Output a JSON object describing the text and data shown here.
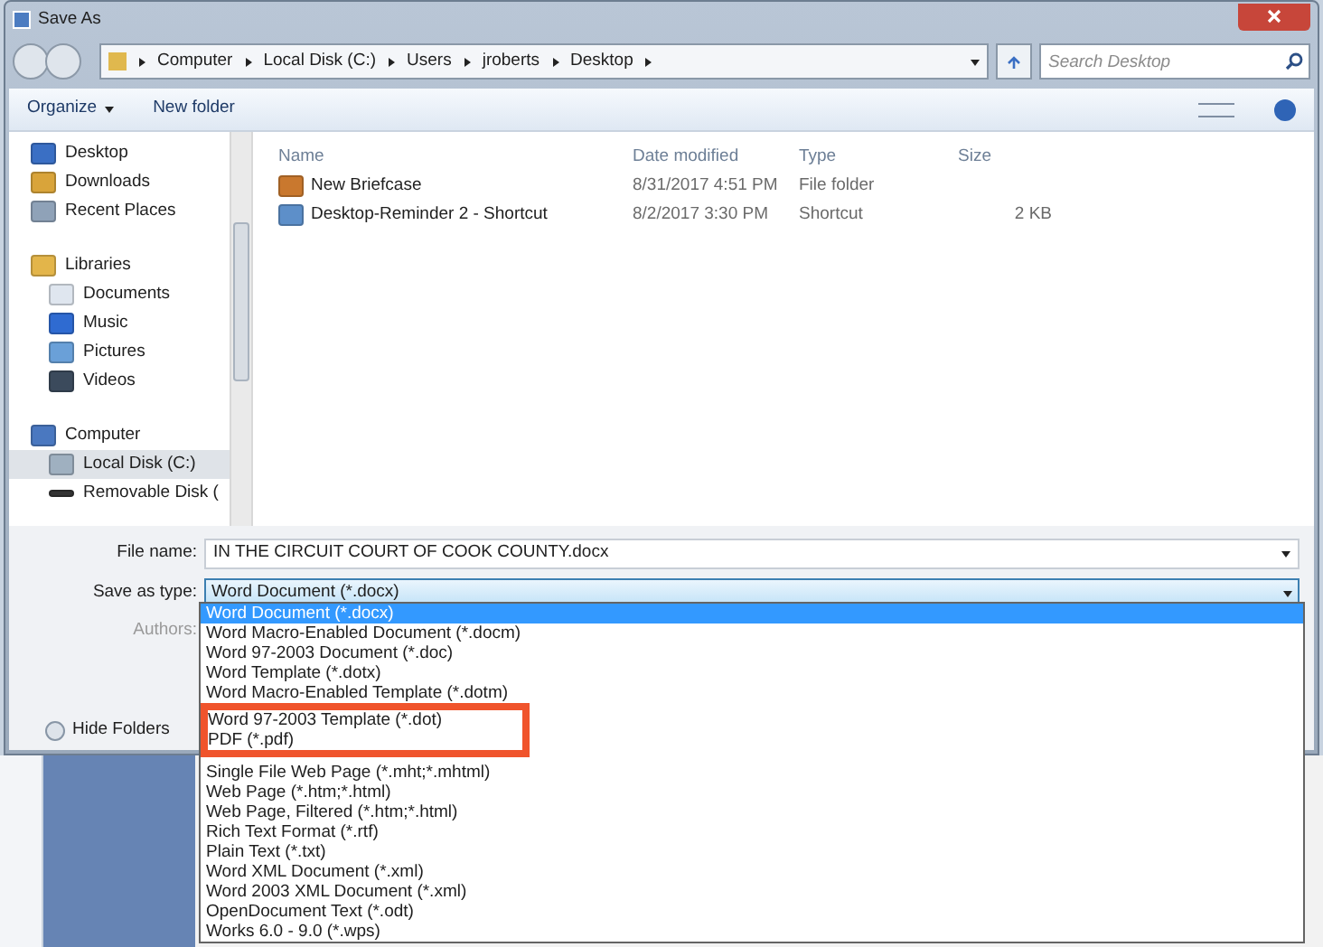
{
  "window": {
    "title": "Save As"
  },
  "address": {
    "breadcrumbs": [
      "Computer",
      "Local Disk (C:)",
      "Users",
      "jroberts",
      "Desktop"
    ]
  },
  "search": {
    "placeholder": "Search Desktop"
  },
  "toolbar": {
    "organize": "Organize",
    "new_folder": "New folder"
  },
  "nav": [
    {
      "label": "Desktop",
      "kind": "desktop",
      "selected": false
    },
    {
      "label": "Downloads",
      "kind": "downloads",
      "selected": false
    },
    {
      "label": "Recent Places",
      "kind": "recent",
      "selected": false
    },
    {
      "label": "Libraries",
      "kind": "library",
      "selected": false,
      "children": [
        {
          "label": "Documents",
          "kind": "document",
          "selected": false
        },
        {
          "label": "Music",
          "kind": "music",
          "selected": false
        },
        {
          "label": "Pictures",
          "kind": "pictures",
          "selected": false
        },
        {
          "label": "Videos",
          "kind": "videos",
          "selected": false
        }
      ]
    },
    {
      "label": "Computer",
      "kind": "computer",
      "selected": false,
      "children": [
        {
          "label": "Local Disk (C:)",
          "kind": "disk",
          "selected": true
        },
        {
          "label": "Removable Disk (",
          "kind": "removable",
          "selected": false
        }
      ]
    }
  ],
  "table": {
    "columns": [
      "Name",
      "Date modified",
      "Type",
      "Size"
    ],
    "rows": [
      {
        "name": "New Briefcase",
        "kind": "briefcase",
        "date": "8/31/2017 4:51 PM",
        "type": "File folder",
        "size": ""
      },
      {
        "name": "Desktop-Reminder 2 - Shortcut",
        "kind": "shortcut",
        "date": "8/2/2017 3:30 PM",
        "type": "Shortcut",
        "size": "2 KB"
      }
    ]
  },
  "form": {
    "file_name_label": "File name:",
    "file_name": "IN THE CIRCUIT COURT OF COOK COUNTY.docx",
    "type_label": "Save as type:",
    "type_value": "Word Document (*.docx)",
    "authors_label": "Authors:",
    "hide_folders": "Hide Folders"
  },
  "type_options": [
    {
      "label": "Word Document (*.docx)",
      "selected": true,
      "highlighted": false
    },
    {
      "label": "Word Macro-Enabled Document (*.docm)",
      "selected": false,
      "highlighted": false
    },
    {
      "label": "Word 97-2003 Document (*.doc)",
      "selected": false,
      "highlighted": false
    },
    {
      "label": "Word Template (*.dotx)",
      "selected": false,
      "highlighted": false
    },
    {
      "label": "Word Macro-Enabled Template (*.dotm)",
      "selected": false,
      "highlighted": false
    },
    {
      "label": "Word 97-2003 Template (*.dot)",
      "selected": false,
      "highlighted": true
    },
    {
      "label": "PDF (*.pdf)",
      "selected": false,
      "highlighted": true
    },
    {
      "label": "Single File Web Page (*.mht;*.mhtml)",
      "selected": false,
      "highlighted": false
    },
    {
      "label": "Web Page (*.htm;*.html)",
      "selected": false,
      "highlighted": false
    },
    {
      "label": "Web Page, Filtered (*.htm;*.html)",
      "selected": false,
      "highlighted": false
    },
    {
      "label": "Rich Text Format (*.rtf)",
      "selected": false,
      "highlighted": false
    },
    {
      "label": "Plain Text (*.txt)",
      "selected": false,
      "highlighted": false
    },
    {
      "label": "Word XML Document (*.xml)",
      "selected": false,
      "highlighted": false
    },
    {
      "label": "Word 2003 XML Document (*.xml)",
      "selected": false,
      "highlighted": false
    },
    {
      "label": "OpenDocument Text (*.odt)",
      "selected": false,
      "highlighted": false
    },
    {
      "label": "Works 6.0 - 9.0 (*.wps)",
      "selected": false,
      "highlighted": false
    }
  ]
}
